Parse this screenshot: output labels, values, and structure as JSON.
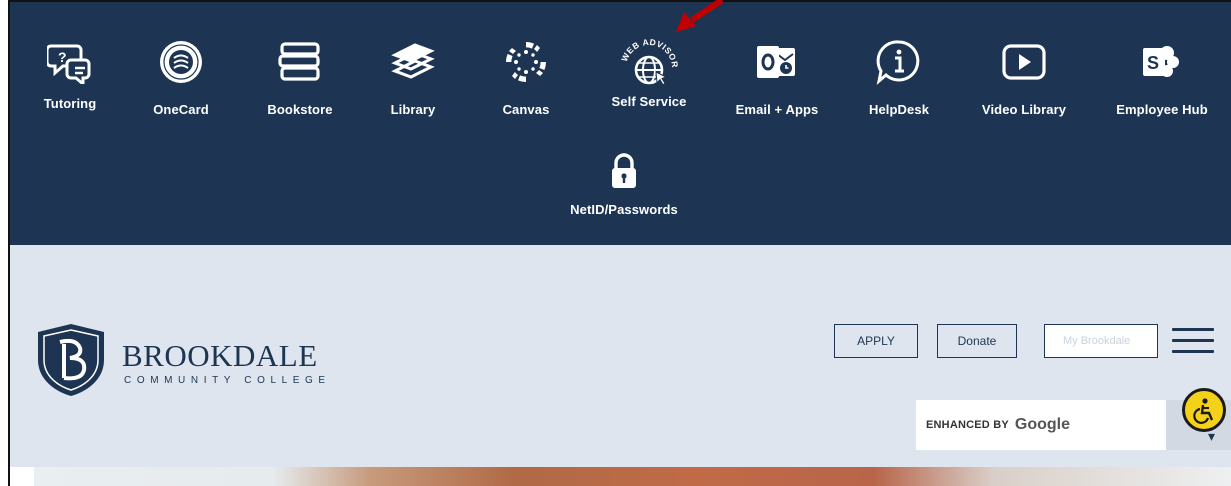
{
  "nav": {
    "items": [
      {
        "label": "Tutoring",
        "icon": "chat-question-icon"
      },
      {
        "label": "OneCard",
        "icon": "college-seal-icon"
      },
      {
        "label": "Bookstore",
        "icon": "books-stack-icon"
      },
      {
        "label": "Library",
        "icon": "open-book-icon"
      },
      {
        "label": "Canvas",
        "icon": "canvas-logo-icon"
      },
      {
        "label": "Self Service",
        "icon": "web-advisor-globe-icon",
        "badge": "WEB ADVISOR"
      },
      {
        "label": "Email + Apps",
        "icon": "outlook-icon"
      },
      {
        "label": "HelpDesk",
        "icon": "info-bubble-icon"
      },
      {
        "label": "Video Library",
        "icon": "play-button-icon"
      },
      {
        "label": "Employee Hub",
        "icon": "sharepoint-icon"
      },
      {
        "label": "NetID/Passwords",
        "icon": "padlock-icon"
      }
    ]
  },
  "logo": {
    "name": "BROOKDALE",
    "subtitle": "COMMUNITY COLLEGE"
  },
  "header": {
    "apply_label": "APPLY",
    "donate_label": "Donate",
    "my_brookdale_label": "My Brookdale"
  },
  "search": {
    "enhanced_by": "ENHANCED BY",
    "provider": "Google"
  },
  "colors": {
    "navy": "#1d3553",
    "header_bg": "#dfe5ee",
    "arrow_red": "#c00000",
    "accessibility_yellow": "#f5d21a"
  }
}
